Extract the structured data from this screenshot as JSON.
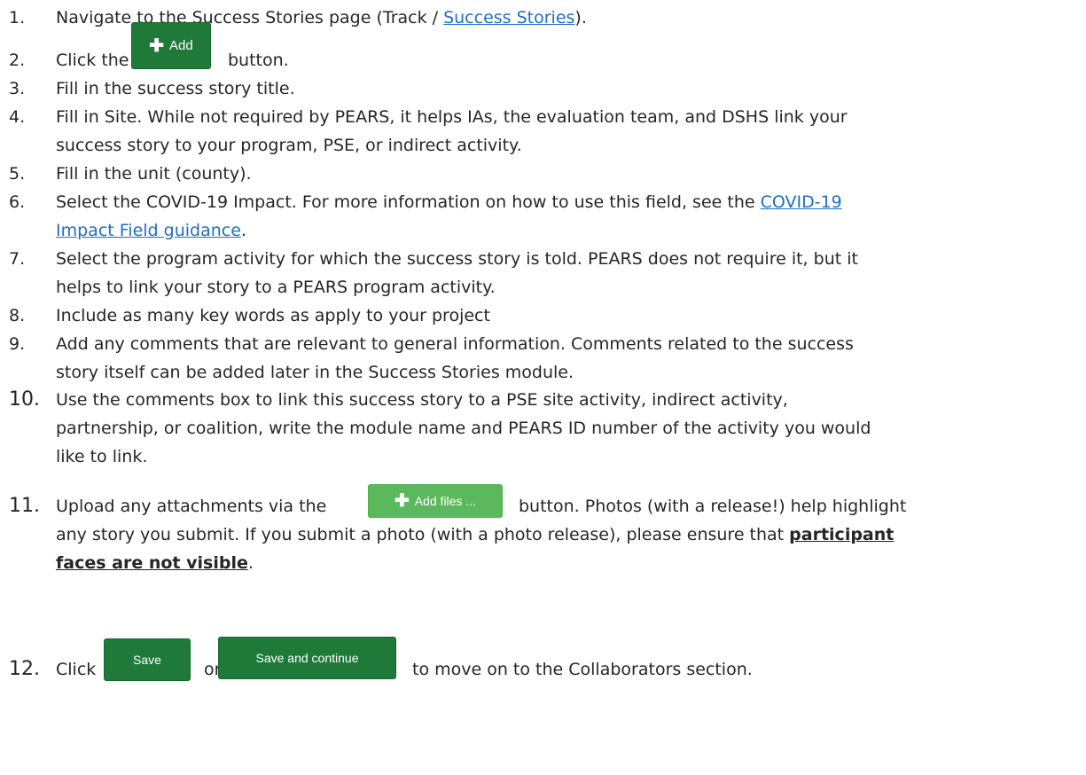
{
  "steps": [
    {
      "num": "1.",
      "pre": "Navigate to the Success Stories page (Track / ",
      "link": "Success Stories",
      "post": ")."
    },
    {
      "num": "2.",
      "pre": "Click the",
      "post": "button.",
      "button": "Add"
    },
    {
      "num": "3.",
      "text": "Fill in the success story title."
    },
    {
      "num": "4.",
      "line1": "Fill in Site. While not required by PEARS, it helps IAs, the evaluation team, and DSHS link your",
      "line2": "success story to your program, PSE, or indirect activity."
    },
    {
      "num": "5.",
      "text": "Fill in the unit (county)."
    },
    {
      "num": "6.",
      "line1_pre": "Select the COVID-19 Impact. For more information on how to use this field, see the ",
      "line1_link": "COVID-19",
      "line2_link": "Impact Field guidance",
      "line2_post": "."
    },
    {
      "num": "7.",
      "line1": "Select the program activity for which the success story is told. PEARS does not require it, but it",
      "line2": "helps to link your story to a PEARS program activity."
    },
    {
      "num": "8.",
      "text": "Include as many key words as apply to your project"
    },
    {
      "num": "9.",
      "line1": "Add any comments that are relevant to general information. Comments related to the success",
      "line2": "story itself can be added later in the Success Stories module."
    },
    {
      "num": "10.",
      "line1": "Use the comments box to link this success story to a PSE site activity, indirect activity,",
      "line2": "partnership, or coalition, write the module name and PEARS ID number of the activity you would",
      "line3": "like to link."
    },
    {
      "num": "11.",
      "line1_pre": "Upload any attachments via the",
      "button": "Add files ...",
      "line1_post": "button. Photos (with a release!) help highlight",
      "line2_pre": "any story you submit. If you submit a photo (with a photo release), please ensure that ",
      "line2_bold": "participant",
      "line3_bold": "faces are not visible",
      "line3_post": "."
    },
    {
      "num": "12.",
      "pre": "Click",
      "mid": "or",
      "post": "to move on to the Collaborators section.",
      "button1": "Save",
      "button2": "Save and continue"
    }
  ],
  "colors": {
    "link": "#1f6fc5",
    "button_dark_green": "#1f7a3a",
    "button_light_green": "#5cb85c"
  },
  "icons": [
    "plus-icon"
  ]
}
